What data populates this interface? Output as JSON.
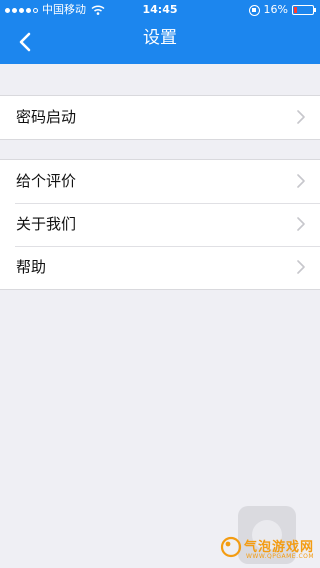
{
  "status_bar": {
    "carrier": "中国移动",
    "time": "14:45",
    "battery": "16%",
    "signal_dots_filled": 4,
    "signal_dots_total": 5
  },
  "header": {
    "title": "设置",
    "back_icon": "chevron-left-icon"
  },
  "settings": {
    "group1": [
      {
        "label": "密码启动"
      }
    ],
    "group2": [
      {
        "label": "给个评价"
      },
      {
        "label": "关于我们"
      },
      {
        "label": "帮助"
      }
    ]
  },
  "watermark": {
    "name": "气泡游戏网",
    "url": "WWW.QPGAME.COM"
  },
  "colors": {
    "accent": "#1c86ee",
    "background": "#efeff4",
    "battery_low": "#ff3b30",
    "watermark": "#f39c12"
  }
}
